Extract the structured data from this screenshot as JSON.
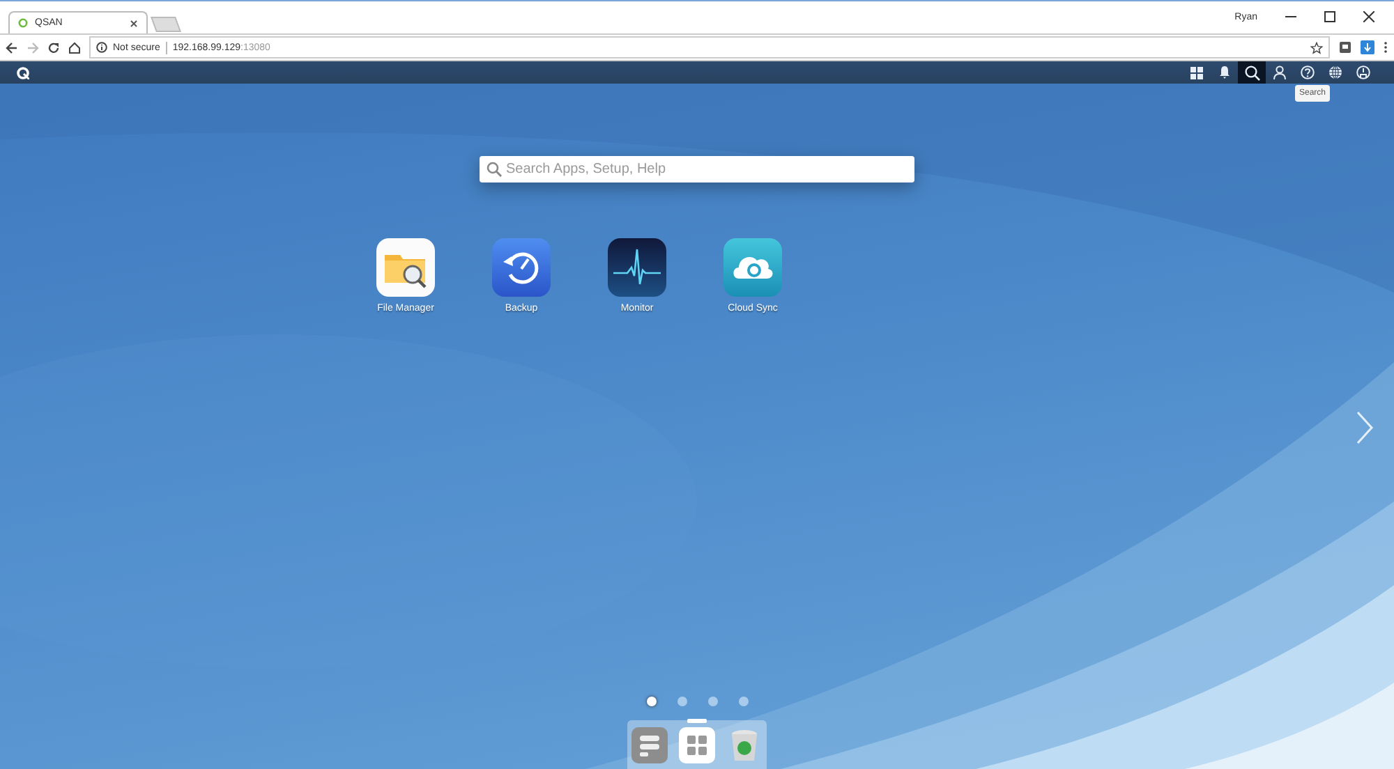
{
  "browser": {
    "tab_title": "QSAN",
    "user": "Ryan",
    "security": "Not secure",
    "url_host": "192.168.99.129",
    "url_port": ":13080"
  },
  "app_bar": {
    "icons": [
      {
        "kind": "apps",
        "selected": false
      },
      {
        "kind": "bell",
        "selected": false
      },
      {
        "kind": "search",
        "selected": true
      },
      {
        "kind": "user",
        "selected": false
      },
      {
        "kind": "help",
        "selected": false
      },
      {
        "kind": "globe",
        "selected": false
      },
      {
        "kind": "gauge",
        "selected": false
      }
    ],
    "tooltip": "Search"
  },
  "search": {
    "placeholder": "Search Apps, Setup, Help"
  },
  "apps": [
    {
      "kind": "files",
      "label": "File Manager"
    },
    {
      "kind": "backup",
      "label": "Backup"
    },
    {
      "kind": "monitor",
      "label": "Monitor"
    },
    {
      "kind": "cloud",
      "label": "Cloud Sync"
    }
  ],
  "pages": [
    {
      "selected": true
    },
    {
      "selected": false
    },
    {
      "selected": false
    },
    {
      "selected": false
    }
  ],
  "dock": [
    {
      "kind": "storage",
      "selected": false
    },
    {
      "kind": "apps",
      "selected": true
    },
    {
      "kind": "trash",
      "selected": false
    }
  ]
}
